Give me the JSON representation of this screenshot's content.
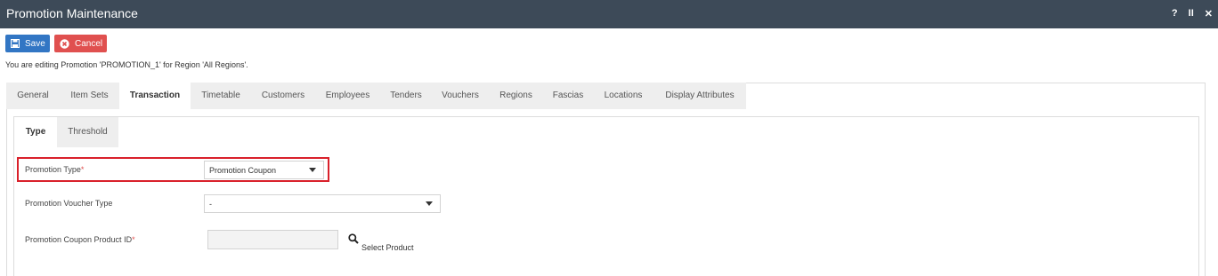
{
  "window": {
    "title": "Promotion Maintenance",
    "controls": [
      "?",
      "II",
      "✕"
    ]
  },
  "toolbar": {
    "save_label": "Save",
    "cancel_label": "Cancel"
  },
  "edit_info": "You are editing Promotion 'PROMOTION_1' for Region 'All Regions'.",
  "tabs": [
    {
      "label": "General",
      "active": false
    },
    {
      "label": "Item Sets",
      "active": false
    },
    {
      "label": "Transaction",
      "active": true
    },
    {
      "label": "Timetable",
      "active": false
    },
    {
      "label": "Customers",
      "active": false
    },
    {
      "label": "Employees",
      "active": false
    },
    {
      "label": "Tenders",
      "active": false
    },
    {
      "label": "Vouchers",
      "active": false
    },
    {
      "label": "Regions",
      "active": false
    },
    {
      "label": "Fascias",
      "active": false
    },
    {
      "label": "Locations",
      "active": false
    },
    {
      "label": "Display Attributes",
      "active": false
    }
  ],
  "subtabs": [
    {
      "label": "Type",
      "active": true
    },
    {
      "label": "Threshold",
      "active": false
    }
  ],
  "form": {
    "promotion_type_label": "Promotion Type",
    "promotion_type_value": "Promotion Coupon",
    "voucher_type_label": "Promotion Voucher Type",
    "voucher_type_value": "-",
    "coupon_product_label": "Promotion Coupon Product ID",
    "coupon_product_value": "",
    "required_marker": "*",
    "select_product_label": "Select Product"
  },
  "colors": {
    "titlebar": "#3d4a58",
    "save": "#3276c4",
    "cancel": "#e0504f",
    "highlight": "#d9202a"
  }
}
